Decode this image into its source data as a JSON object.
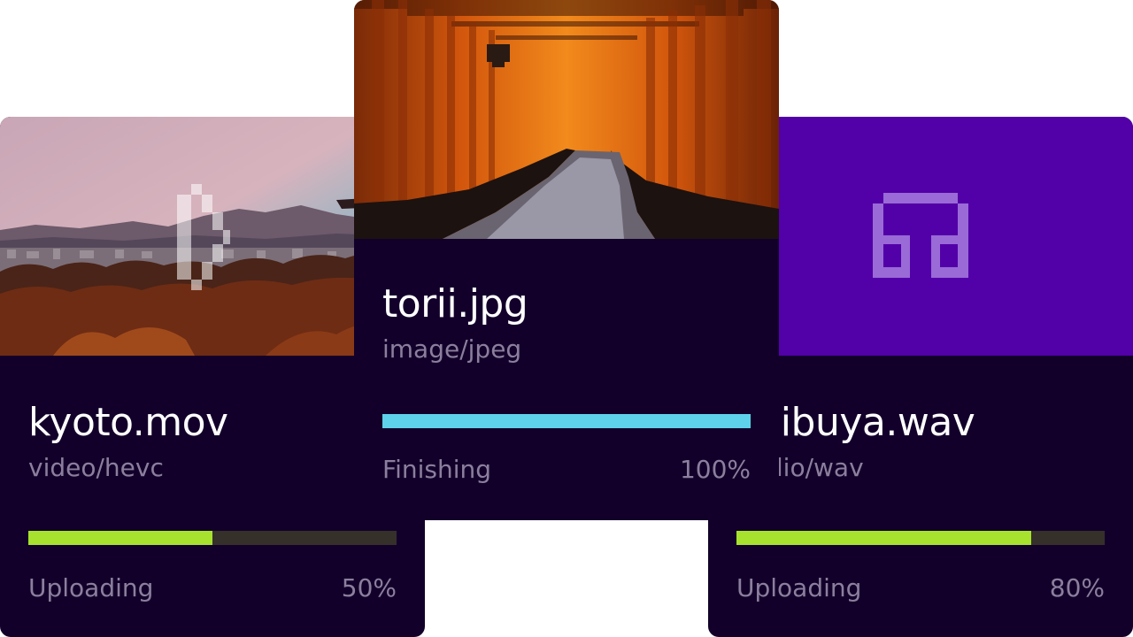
{
  "uploads": [
    {
      "filename": "kyoto.mov",
      "mimetype": "video/hevc",
      "status": "Uploading",
      "percent_label": "50%",
      "progress": 0.5,
      "thumbnail": "city-landscape-photo",
      "overlay_icon": "play-icon",
      "bar_color": "#a6e22e"
    },
    {
      "filename": "torii.jpg",
      "mimetype": "image/jpeg",
      "status": "Finishing",
      "percent_label": "100%",
      "progress": 1.0,
      "thumbnail": "torii-gate-path-photo",
      "bar_color": "#5ed2ea"
    },
    {
      "filename": "shibuya.wav",
      "mimetype": "audio/wav",
      "status": "Uploading",
      "percent_label": "80%",
      "progress": 0.8,
      "thumbnail": "audio-placeholder",
      "overlay_icon": "headphones-icon",
      "bar_color": "#a6e22e"
    }
  ],
  "colors": {
    "card_bg": "#12002a",
    "muted_text": "#8b7f9d",
    "track": "#35302a",
    "audio_thumb_bg": "#5200a8"
  }
}
